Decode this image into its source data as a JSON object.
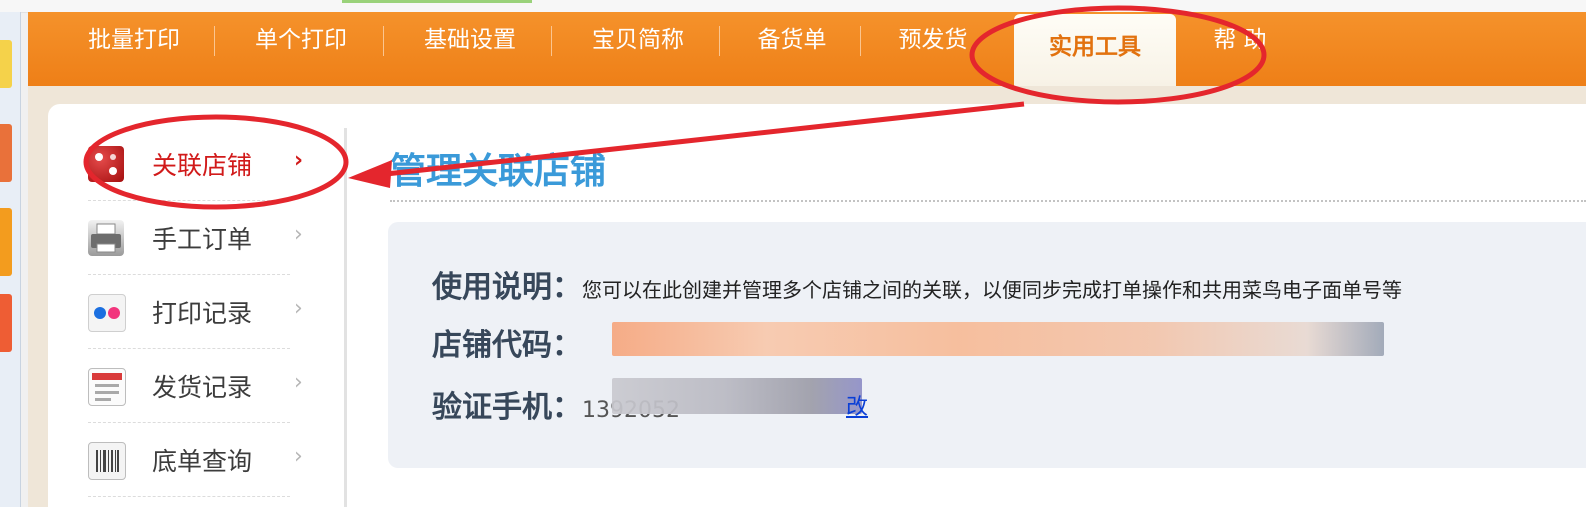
{
  "nav": {
    "items": [
      {
        "label": "批量打印"
      },
      {
        "label": "单个打印"
      },
      {
        "label": "基础设置"
      },
      {
        "label": "宝贝简称"
      },
      {
        "label": "备货单"
      },
      {
        "label": "预发货"
      },
      {
        "label": "实用工具"
      },
      {
        "label": "帮 助"
      }
    ],
    "active_index": 6
  },
  "menu": {
    "items": [
      {
        "label": "关联店铺",
        "arrow": "›",
        "icon": "dice-icon"
      },
      {
        "label": "手工订单",
        "arrow": "›",
        "icon": "printer-icon"
      },
      {
        "label": "打印记录",
        "arrow": "›",
        "icon": "flickr-dots-icon"
      },
      {
        "label": "发货记录",
        "arrow": "›",
        "icon": "form-icon"
      },
      {
        "label": "底单查询",
        "arrow": "›",
        "icon": "barcode-icon"
      }
    ],
    "active_index": 0
  },
  "main": {
    "title": "管理关联店铺",
    "usage_label": "使用说明：",
    "usage_text": "您可以在此创建并管理多个店铺之间的关联，以便同步完成打单操作和共用菜鸟电子面单号等",
    "store_code_label": "店铺代码：",
    "phone_label": "验证手机：",
    "phone_value_partial": "1392052",
    "link_partial": "改"
  },
  "colors": {
    "nav_orange": "#f08a1f",
    "active_tab_text": "#e2720f",
    "menu_active": "#d11a1a",
    "title_blue": "#3a9ad9",
    "annotation_red": "#e4262d"
  }
}
